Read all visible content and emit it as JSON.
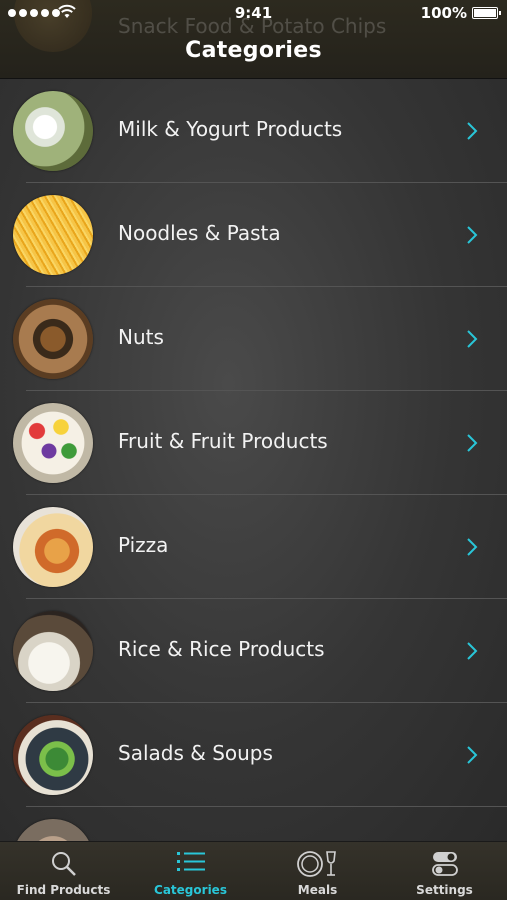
{
  "status_bar": {
    "time": "9:41",
    "battery": "100%"
  },
  "header": {
    "title": "Categories",
    "ghost_text": "Snack Food & Potato Chips"
  },
  "categories": [
    {
      "label": "Milk & Yogurt Products",
      "thumb": "milk-image"
    },
    {
      "label": "Noodles & Pasta",
      "thumb": "pasta-image"
    },
    {
      "label": "Nuts",
      "thumb": "nuts-image"
    },
    {
      "label": "Fruit & Fruit Products",
      "thumb": "fruit-image"
    },
    {
      "label": "Pizza",
      "thumb": "pizza-image"
    },
    {
      "label": "Rice & Rice Products",
      "thumb": "rice-image"
    },
    {
      "label": "Salads & Soups",
      "thumb": "salad-image"
    }
  ],
  "tabbar": {
    "tabs": [
      {
        "label": "Find Products",
        "icon": "search-icon"
      },
      {
        "label": "Categories",
        "icon": "list-icon",
        "active": true
      },
      {
        "label": "Meals",
        "icon": "plate-glass-icon"
      },
      {
        "label": "Settings",
        "icon": "toggles-icon"
      }
    ]
  },
  "colors": {
    "accent": "#29c6d8",
    "background": "#2b2a27"
  }
}
